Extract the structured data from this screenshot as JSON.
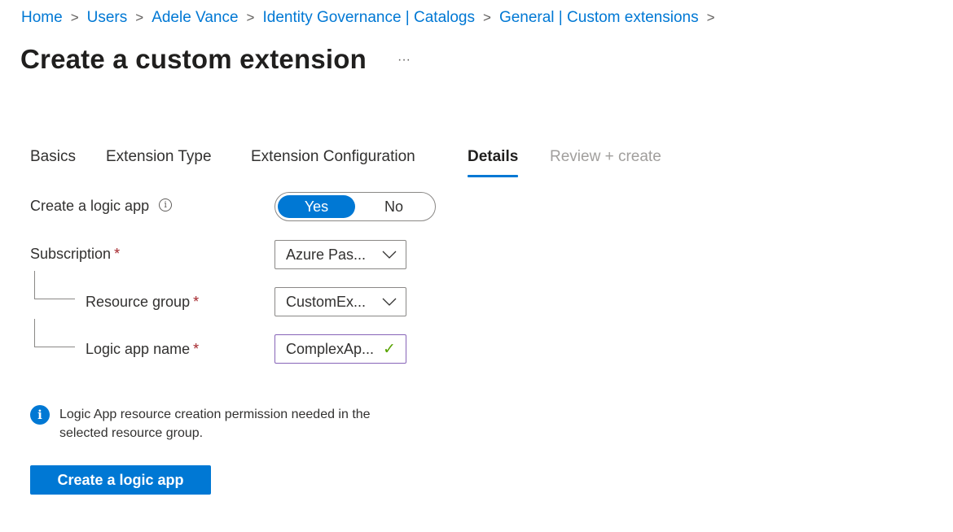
{
  "breadcrumb": [
    "Home",
    "Users",
    "Adele Vance",
    "Identity Governance | Catalogs",
    "General | Custom extensions"
  ],
  "breadcrumb_separator": ">",
  "page_title": "Create a custom extension",
  "more_label": "···",
  "tabs": [
    {
      "label": "Basics",
      "state": "normal"
    },
    {
      "label": "Extension Type",
      "state": "normal"
    },
    {
      "label": "Extension Configuration",
      "state": "normal"
    },
    {
      "label": "Details",
      "state": "active"
    },
    {
      "label": "Review + create",
      "state": "disabled"
    }
  ],
  "form": {
    "create_logic_app_label": "Create a logic app",
    "info_icon_glyph": "i",
    "toggle": {
      "yes": "Yes",
      "no": "No",
      "selected": "Yes"
    },
    "subscription_label": "Subscription",
    "subscription_value": "Azure Pas...",
    "resource_group_label": "Resource group",
    "resource_group_value": "CustomEx...",
    "logic_app_name_label": "Logic app name",
    "logic_app_name_value": "ComplexAp...",
    "required_mark": "*",
    "valid_mark": "✓"
  },
  "info_message": {
    "icon": "info-icon",
    "glyph": "i",
    "text": "Logic App resource creation permission needed in the selected resource group."
  },
  "primary_button": "Create a logic app",
  "colors": {
    "accent": "#0078d4",
    "required": "#a4262c",
    "valid_border": "#8764b8",
    "valid_check": "#57a300",
    "disabled_text": "#a19f9d"
  }
}
